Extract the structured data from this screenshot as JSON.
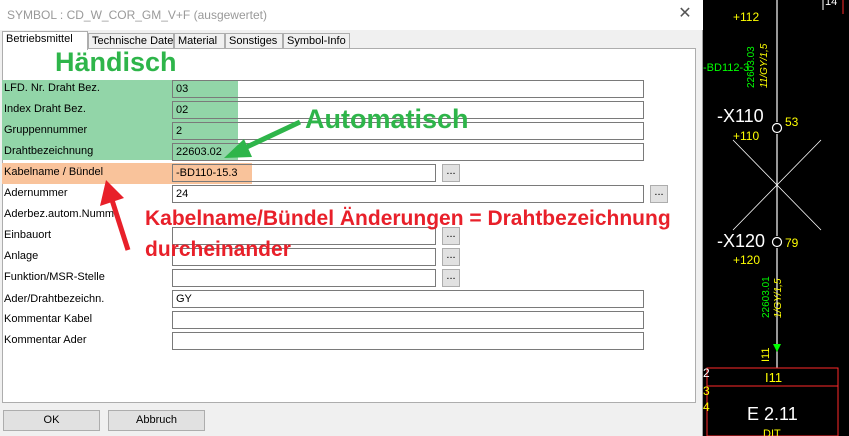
{
  "dialog": {
    "title": "SYMBOL : CD_W_COR_GM_V+F   (ausgewertet)",
    "close_glyph": "✕",
    "tabs": [
      {
        "label": "Betriebsmittel",
        "active": true
      },
      {
        "label": "Technische Daten",
        "active": false
      },
      {
        "label": "Material",
        "active": false
      },
      {
        "label": "Sonstiges",
        "active": false
      },
      {
        "label": "Symbol-Info",
        "active": false
      }
    ],
    "fields": [
      {
        "label": "LFD. Nr. Draht Bez.",
        "value": "03"
      },
      {
        "label": "Index Draht Bez.",
        "value": "02"
      },
      {
        "label": "Gruppennummer",
        "value": "2"
      },
      {
        "label": "Drahtbezeichnung",
        "value": "22603.02"
      },
      {
        "label": "Kabelname / Bündel",
        "value": "-BD110-15.3"
      },
      {
        "label": "Adernummer",
        "value": "24"
      },
      {
        "label": "Aderbez.autom.Numm.",
        "value": ""
      },
      {
        "label": "Einbauort",
        "value": ""
      },
      {
        "label": "Anlage",
        "value": ""
      },
      {
        "label": "Funktion/MSR-Stelle",
        "value": ""
      },
      {
        "label": "Ader/Drahtbezeichn.",
        "value": "GY"
      },
      {
        "label": "Kommentar Kabel",
        "value": ""
      },
      {
        "label": "Kommentar Ader",
        "value": ""
      }
    ],
    "browse_label": "...",
    "ok_label": "OK",
    "cancel_label": "Abbruch"
  },
  "annotations": {
    "manual": "Händisch",
    "automatic": "Automatisch",
    "issue_line1": "Kabelname/Bündel Änderungen = Drahtbezeichnung",
    "issue_line2": "durcheinander",
    "colors": {
      "manual": "#92d5a8",
      "automatic_text": "#2eb54a",
      "issue_highlight": "#f9c39b",
      "issue_text": "#e8202a"
    }
  },
  "cad": {
    "background": "#000000",
    "labels": {
      "top_ref": "+112",
      "top_num": "14",
      "bundle_ref": "-BD112-3",
      "wire_top": "22603.03",
      "wire_top_sub": "11/GY/1,5",
      "x110": "-X110",
      "x110_sub": "+110",
      "pin53": "53",
      "x120": "-X120",
      "x120_sub": "+120",
      "pin79": "79",
      "wire_bottom": "22603.01",
      "wire_bottom_sub": "1/GY/1,5",
      "i11_vertical": "I11",
      "i11_box": "I11",
      "e211": "E 2.11",
      "dit": "DIT",
      "left_2": "2",
      "left_3": "3",
      "left_4": "4"
    }
  }
}
